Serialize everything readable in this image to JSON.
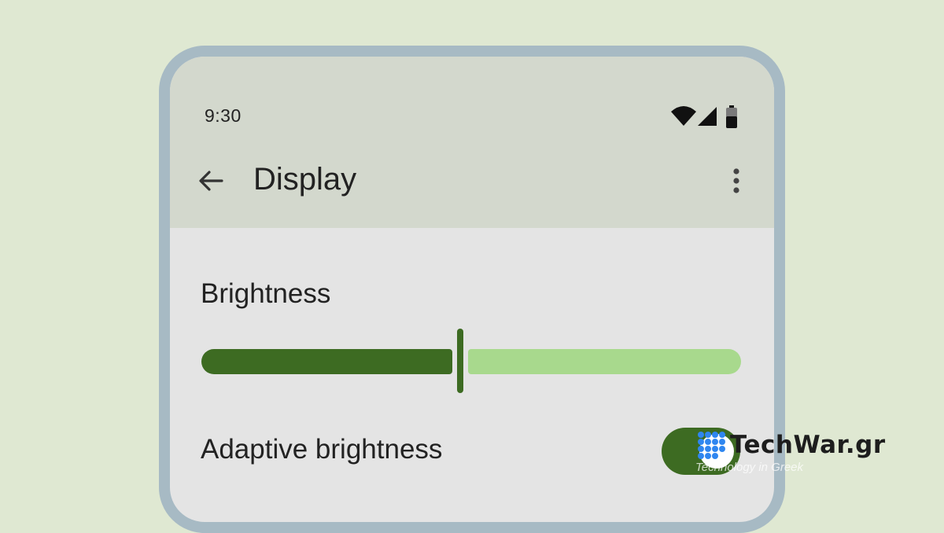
{
  "status_bar": {
    "time": "9:30",
    "icons": [
      "wifi-icon",
      "cell-signal-icon",
      "battery-icon"
    ]
  },
  "app_bar": {
    "title": "Display",
    "back_icon": "arrow-back-icon",
    "menu_icon": "more-vert-icon"
  },
  "brightness": {
    "label": "Brightness",
    "level": 0.48
  },
  "adaptive_brightness": {
    "label": "Adaptive brightness",
    "enabled": true
  },
  "watermark": {
    "text": "TechWar.gr",
    "tagline": "Technology in Greek"
  },
  "colors": {
    "accent": "#3d6b22",
    "track_inactive": "#a8d98d",
    "background": "#dfe8d2",
    "frame": "#a7bac4",
    "header": "#d3d8cd"
  }
}
